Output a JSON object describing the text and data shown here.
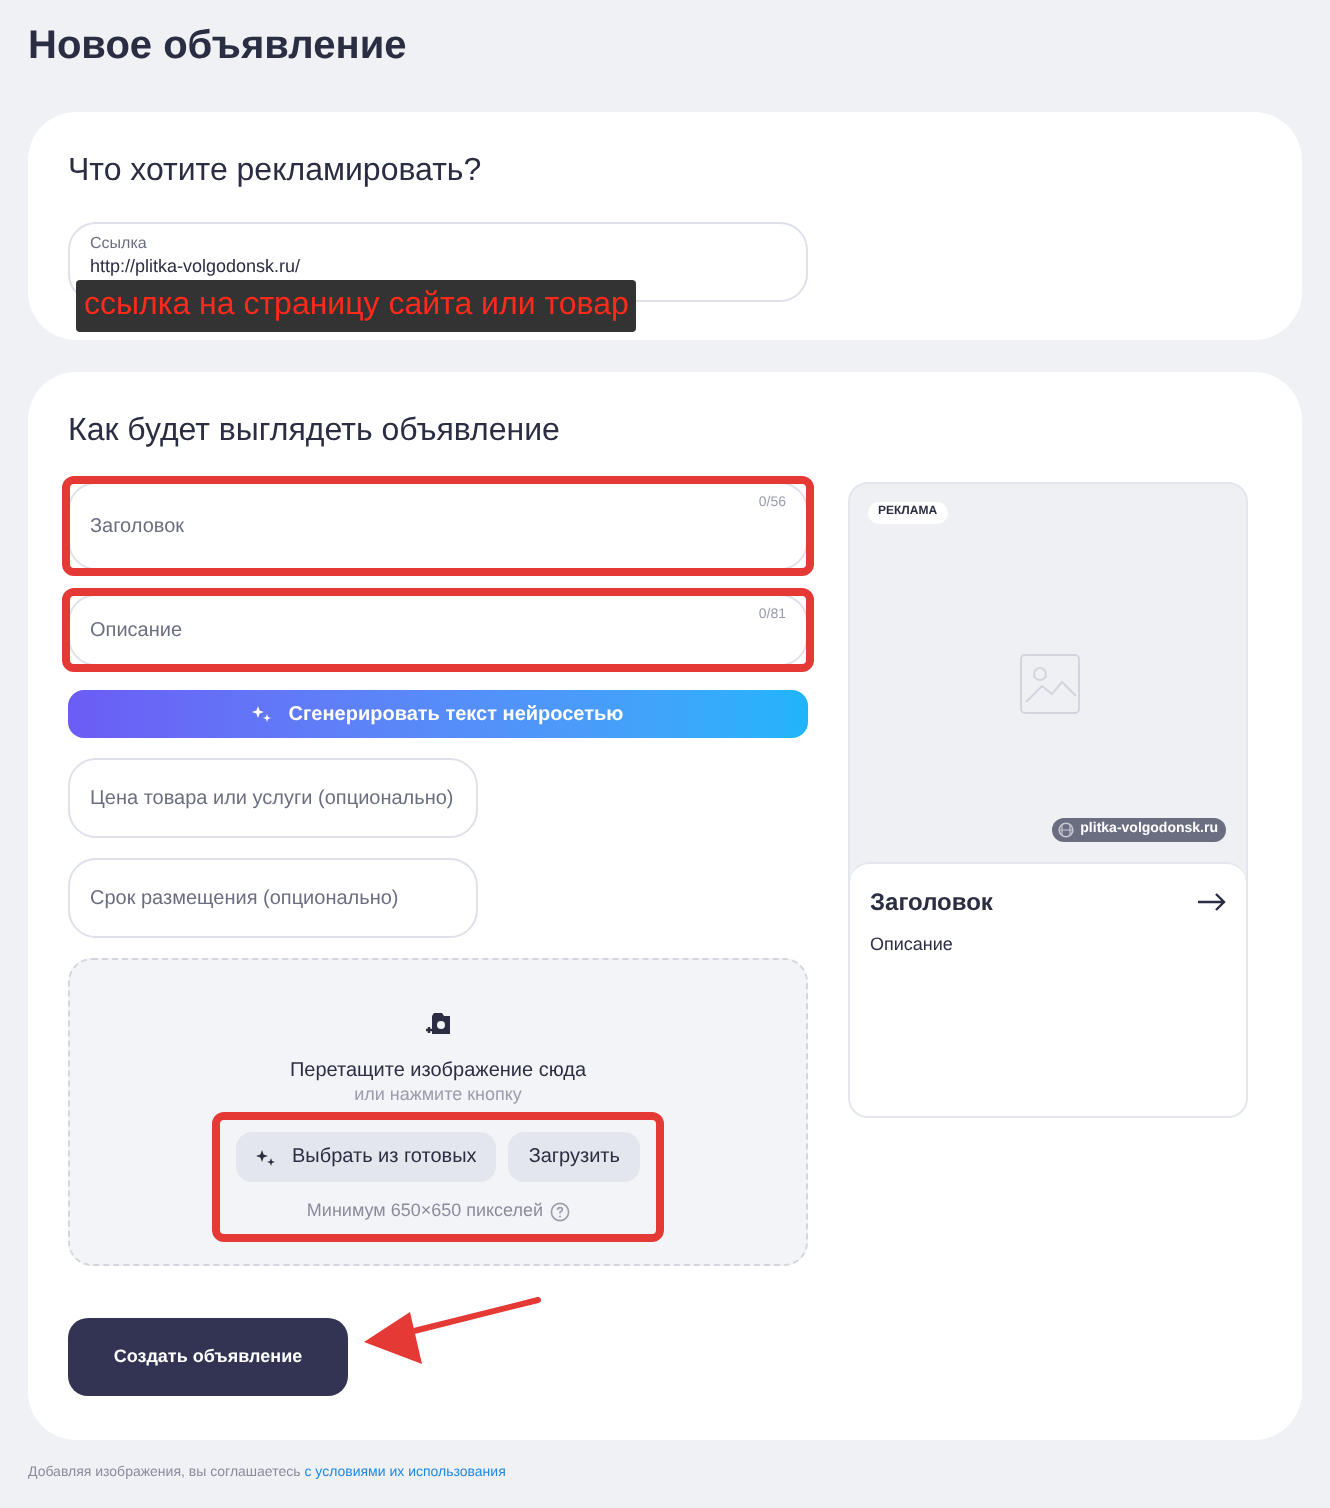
{
  "page_title": "Новое объявление",
  "link_section": {
    "heading": "Что хотите рекламировать?",
    "field": {
      "label": "Ссылка",
      "value": "http://plitka-volgodonsk.ru/"
    },
    "annotation": "ссылка на страницу сайта или товар"
  },
  "ad_section": {
    "heading": "Как будет выглядеть объявление",
    "fields": [
      {
        "placeholder": "Заголовок",
        "counter": "0/56",
        "highlighted": true
      },
      {
        "placeholder": "Описание",
        "counter": "0/81",
        "highlighted": true
      }
    ],
    "generate_button": "Сгенерировать текст нейросетью",
    "optional_fields": [
      {
        "placeholder": "Цена товара или услуги (опционально)"
      },
      {
        "placeholder": "Срок размещения (опционально)"
      }
    ],
    "dropzone": {
      "title": "Перетащите изображение сюда",
      "subtitle": "или нажмите кнопку",
      "buttons": [
        {
          "label": "Выбрать из готовых",
          "kind": "sparkle"
        },
        {
          "label": "Загрузить",
          "kind": "plain"
        }
      ],
      "hint": "Минимум 650×650 пикселей",
      "highlighted": true
    },
    "preview": {
      "badge": "РЕКЛАМА",
      "domain": "plitka-volgodonsk.ru",
      "title": "Заголовок",
      "description": "Описание"
    },
    "submit_button": "Создать объявление",
    "submit_arrow": true
  },
  "footer": {
    "text": "Добавляя изображения, вы соглашаетесь ",
    "link": "с условиями их использования"
  }
}
